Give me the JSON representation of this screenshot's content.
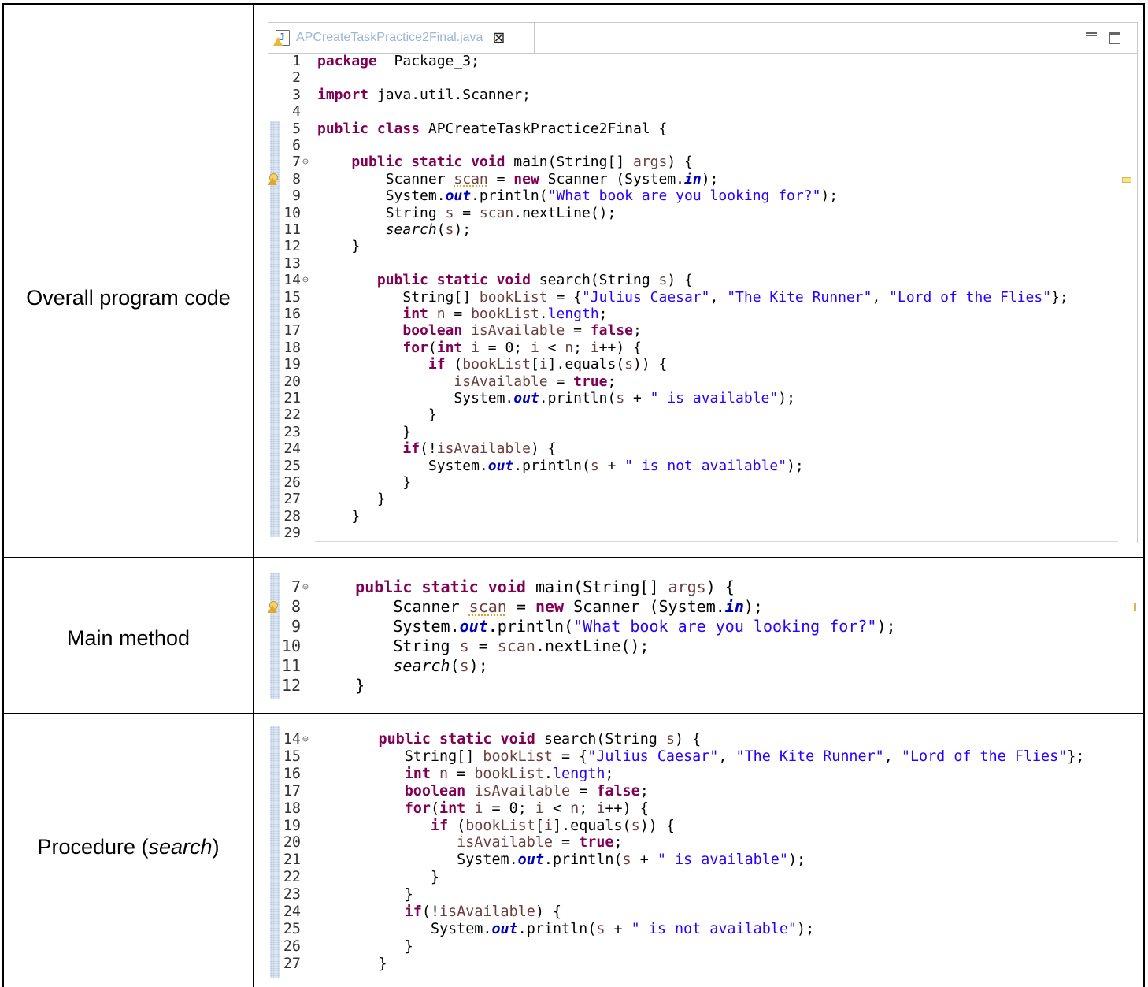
{
  "rows": [
    {
      "label": "Overall program code"
    },
    {
      "label": "Main method"
    },
    {
      "label_prefix": "Procedure (",
      "label_italic": "search",
      "label_suffix": ")"
    }
  ],
  "editor": {
    "tab_title": "APCreateTaskPractice2Final.java",
    "close_glyph": "⊠",
    "warning_line": 8
  },
  "full_code": [
    {
      "n": "1",
      "fold": "",
      "tokens": [
        [
          "kw",
          "package"
        ],
        [
          "",
          "  Package_3;"
        ]
      ]
    },
    {
      "n": "2",
      "fold": "",
      "tokens": []
    },
    {
      "n": "3",
      "fold": "",
      "tokens": [
        [
          "kw",
          "import"
        ],
        [
          "",
          " java.util.Scanner;"
        ]
      ]
    },
    {
      "n": "4",
      "fold": "",
      "tokens": []
    },
    {
      "n": "5",
      "fold": "",
      "tokens": [
        [
          "kw",
          "public class"
        ],
        [
          "",
          " APCreateTaskPractice2Final {"
        ]
      ]
    },
    {
      "n": "6",
      "fold": "",
      "tokens": []
    },
    {
      "n": "7",
      "fold": "⊖",
      "tokens": [
        [
          "",
          "    "
        ],
        [
          "kw",
          "public static void"
        ],
        [
          "",
          " main(String[] "
        ],
        [
          "var",
          "args"
        ],
        [
          "",
          ") {"
        ]
      ]
    },
    {
      "n": "8",
      "fold": "",
      "tokens": [
        [
          "",
          "        Scanner "
        ],
        [
          "var warn-underline",
          "scan"
        ],
        [
          "",
          " = "
        ],
        [
          "kw",
          "new"
        ],
        [
          "",
          " Scanner (System."
        ],
        [
          "fld",
          "in"
        ],
        [
          "",
          ");"
        ]
      ]
    },
    {
      "n": "9",
      "fold": "",
      "tokens": [
        [
          "",
          "        System."
        ],
        [
          "fld",
          "out"
        ],
        [
          "",
          ".println("
        ],
        [
          "str",
          "\"What book are you looking for?\""
        ],
        [
          "",
          ");"
        ]
      ]
    },
    {
      "n": "10",
      "fold": "",
      "tokens": [
        [
          "",
          "        String "
        ],
        [
          "var",
          "s"
        ],
        [
          "",
          " = "
        ],
        [
          "var",
          "scan"
        ],
        [
          "",
          ".nextLine();"
        ]
      ]
    },
    {
      "n": "11",
      "fold": "",
      "tokens": [
        [
          "",
          "        "
        ],
        [
          "it",
          "search"
        ],
        [
          "",
          "("
        ],
        [
          "var",
          "s"
        ],
        [
          "",
          ");"
        ]
      ]
    },
    {
      "n": "12",
      "fold": "",
      "tokens": [
        [
          "",
          "    }"
        ]
      ]
    },
    {
      "n": "13",
      "fold": "",
      "tokens": []
    },
    {
      "n": "14",
      "fold": "⊖",
      "tokens": [
        [
          "",
          "       "
        ],
        [
          "kw",
          "public static void"
        ],
        [
          "",
          " search(String "
        ],
        [
          "var",
          "s"
        ],
        [
          "",
          ") {"
        ]
      ]
    },
    {
      "n": "15",
      "fold": "",
      "tokens": [
        [
          "",
          "          String[] "
        ],
        [
          "var",
          "bookList"
        ],
        [
          "",
          " = {"
        ],
        [
          "str",
          "\"Julius Caesar\""
        ],
        [
          "",
          ", "
        ],
        [
          "str",
          "\"The Kite Runner\""
        ],
        [
          "",
          ", "
        ],
        [
          "str",
          "\"Lord of the Flies\""
        ],
        [
          "",
          "};"
        ]
      ]
    },
    {
      "n": "16",
      "fold": "",
      "tokens": [
        [
          "",
          "          "
        ],
        [
          "kw",
          "int"
        ],
        [
          "",
          " "
        ],
        [
          "var",
          "n"
        ],
        [
          "",
          " = "
        ],
        [
          "var",
          "bookList"
        ],
        [
          "",
          "."
        ],
        [
          "str",
          "length"
        ],
        [
          "",
          ";"
        ]
      ]
    },
    {
      "n": "17",
      "fold": "",
      "tokens": [
        [
          "",
          "          "
        ],
        [
          "kw",
          "boolean"
        ],
        [
          "",
          " "
        ],
        [
          "var",
          "isAvailable"
        ],
        [
          "",
          " = "
        ],
        [
          "kw",
          "false"
        ],
        [
          "",
          ";"
        ]
      ]
    },
    {
      "n": "18",
      "fold": "",
      "tokens": [
        [
          "",
          "          "
        ],
        [
          "kw",
          "for"
        ],
        [
          "",
          "("
        ],
        [
          "kw",
          "int"
        ],
        [
          "",
          " "
        ],
        [
          "var",
          "i"
        ],
        [
          "",
          " = 0; "
        ],
        [
          "var",
          "i"
        ],
        [
          "",
          " < "
        ],
        [
          "var",
          "n"
        ],
        [
          "",
          "; "
        ],
        [
          "var",
          "i"
        ],
        [
          "",
          "++) {"
        ]
      ]
    },
    {
      "n": "19",
      "fold": "",
      "tokens": [
        [
          "",
          "             "
        ],
        [
          "kw",
          "if"
        ],
        [
          "",
          " ("
        ],
        [
          "var",
          "bookList"
        ],
        [
          "",
          "["
        ],
        [
          "var",
          "i"
        ],
        [
          "",
          "].equals("
        ],
        [
          "var",
          "s"
        ],
        [
          "",
          ")) {"
        ]
      ]
    },
    {
      "n": "20",
      "fold": "",
      "tokens": [
        [
          "",
          "                "
        ],
        [
          "var",
          "isAvailable"
        ],
        [
          "",
          " = "
        ],
        [
          "kw",
          "true"
        ],
        [
          "",
          ";"
        ]
      ]
    },
    {
      "n": "21",
      "fold": "",
      "tokens": [
        [
          "",
          "                System."
        ],
        [
          "fld",
          "out"
        ],
        [
          "",
          ".println("
        ],
        [
          "var",
          "s"
        ],
        [
          "",
          " + "
        ],
        [
          "str",
          "\" is available\""
        ],
        [
          "",
          ");"
        ]
      ]
    },
    {
      "n": "22",
      "fold": "",
      "tokens": [
        [
          "",
          "             }"
        ]
      ]
    },
    {
      "n": "23",
      "fold": "",
      "tokens": [
        [
          "",
          "          }"
        ]
      ]
    },
    {
      "n": "24",
      "fold": "",
      "tokens": [
        [
          "",
          "          "
        ],
        [
          "kw",
          "if"
        ],
        [
          "",
          "(!"
        ],
        [
          "var",
          "isAvailable"
        ],
        [
          "",
          ") {"
        ]
      ]
    },
    {
      "n": "25",
      "fold": "",
      "tokens": [
        [
          "",
          "             System."
        ],
        [
          "fld",
          "out"
        ],
        [
          "",
          ".println("
        ],
        [
          "var",
          "s"
        ],
        [
          "",
          " + "
        ],
        [
          "str",
          "\" is not available\""
        ],
        [
          "",
          ");"
        ]
      ]
    },
    {
      "n": "26",
      "fold": "",
      "tokens": [
        [
          "",
          "          }"
        ]
      ]
    },
    {
      "n": "27",
      "fold": "",
      "tokens": [
        [
          "",
          "       }"
        ]
      ]
    },
    {
      "n": "28",
      "fold": "",
      "tokens": [
        [
          "",
          "    }"
        ]
      ]
    },
    {
      "n": "29",
      "fold": "",
      "tokens": []
    }
  ],
  "main_excerpt": [
    "7",
    "8",
    "9",
    "10",
    "11",
    "12"
  ],
  "search_excerpt": [
    "14",
    "15",
    "16",
    "17",
    "18",
    "19",
    "20",
    "21",
    "22",
    "23",
    "24",
    "25",
    "26",
    "27"
  ],
  "colors": {
    "keyword": "#7f0055",
    "string": "#2a00ff",
    "field": "#0000c0",
    "variable": "#6a3e3e",
    "tab_title": "#9db4d6"
  }
}
